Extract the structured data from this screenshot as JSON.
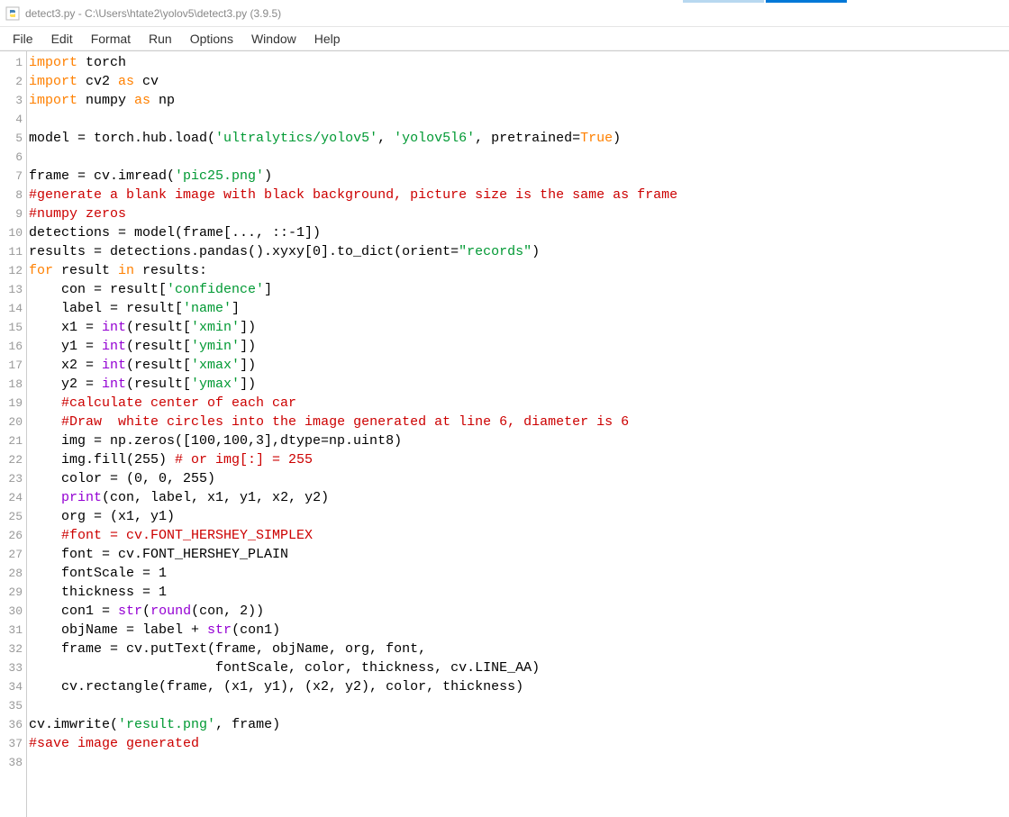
{
  "window": {
    "title": "detect3.py - C:\\Users\\htate2\\yolov5\\detect3.py (3.9.5)"
  },
  "menu": {
    "items": [
      "File",
      "Edit",
      "Format",
      "Run",
      "Options",
      "Window",
      "Help"
    ]
  },
  "code": {
    "lines": [
      [
        {
          "t": "import",
          "c": "kw"
        },
        {
          "t": " torch",
          "c": "blk"
        }
      ],
      [
        {
          "t": "import",
          "c": "kw"
        },
        {
          "t": " cv2 ",
          "c": "blk"
        },
        {
          "t": "as",
          "c": "kw"
        },
        {
          "t": " cv",
          "c": "blk"
        }
      ],
      [
        {
          "t": "import",
          "c": "kw"
        },
        {
          "t": " numpy ",
          "c": "blk"
        },
        {
          "t": "as",
          "c": "kw"
        },
        {
          "t": " np",
          "c": "blk"
        }
      ],
      [],
      [
        {
          "t": "model = torch.hub.load(",
          "c": "blk"
        },
        {
          "t": "'ultralytics/yolov5'",
          "c": "str"
        },
        {
          "t": ", ",
          "c": "blk"
        },
        {
          "t": "'yolov5l6'",
          "c": "str"
        },
        {
          "t": ", pretrained=",
          "c": "blk"
        },
        {
          "t": "True",
          "c": "kw"
        },
        {
          "t": ")",
          "c": "blk"
        }
      ],
      [],
      [
        {
          "t": "frame = cv.imread(",
          "c": "blk"
        },
        {
          "t": "'pic25.png'",
          "c": "str"
        },
        {
          "t": ")",
          "c": "blk"
        }
      ],
      [
        {
          "t": "#generate a blank image with black background, picture size is the same as frame",
          "c": "com"
        }
      ],
      [
        {
          "t": "#numpy zeros",
          "c": "com"
        }
      ],
      [
        {
          "t": "detections = model(frame[..., ::-1])",
          "c": "blk"
        }
      ],
      [
        {
          "t": "results = detections.pandas().xyxy[0].to_dict(orient=",
          "c": "blk"
        },
        {
          "t": "\"records\"",
          "c": "str"
        },
        {
          "t": ")",
          "c": "blk"
        }
      ],
      [
        {
          "t": "for",
          "c": "kw"
        },
        {
          "t": " result ",
          "c": "blk"
        },
        {
          "t": "in",
          "c": "kw"
        },
        {
          "t": " results:",
          "c": "blk"
        }
      ],
      [
        {
          "t": "    con = result[",
          "c": "blk"
        },
        {
          "t": "'confidence'",
          "c": "str"
        },
        {
          "t": "]",
          "c": "blk"
        }
      ],
      [
        {
          "t": "    label = result[",
          "c": "blk"
        },
        {
          "t": "'name'",
          "c": "str"
        },
        {
          "t": "]",
          "c": "blk"
        }
      ],
      [
        {
          "t": "    x1 = ",
          "c": "blk"
        },
        {
          "t": "int",
          "c": "bi"
        },
        {
          "t": "(result[",
          "c": "blk"
        },
        {
          "t": "'xmin'",
          "c": "str"
        },
        {
          "t": "])",
          "c": "blk"
        }
      ],
      [
        {
          "t": "    y1 = ",
          "c": "blk"
        },
        {
          "t": "int",
          "c": "bi"
        },
        {
          "t": "(result[",
          "c": "blk"
        },
        {
          "t": "'ymin'",
          "c": "str"
        },
        {
          "t": "])",
          "c": "blk"
        }
      ],
      [
        {
          "t": "    x2 = ",
          "c": "blk"
        },
        {
          "t": "int",
          "c": "bi"
        },
        {
          "t": "(result[",
          "c": "blk"
        },
        {
          "t": "'xmax'",
          "c": "str"
        },
        {
          "t": "])",
          "c": "blk"
        }
      ],
      [
        {
          "t": "    y2 = ",
          "c": "blk"
        },
        {
          "t": "int",
          "c": "bi"
        },
        {
          "t": "(result[",
          "c": "blk"
        },
        {
          "t": "'ymax'",
          "c": "str"
        },
        {
          "t": "])",
          "c": "blk"
        }
      ],
      [
        {
          "t": "    ",
          "c": "blk"
        },
        {
          "t": "#calculate center of each car",
          "c": "com"
        }
      ],
      [
        {
          "t": "    ",
          "c": "blk"
        },
        {
          "t": "#Draw  white circles into the image generated at line 6, diameter is 6",
          "c": "com"
        }
      ],
      [
        {
          "t": "    img = np.zeros([100,100,3],dtype=np.uint8)",
          "c": "blk"
        }
      ],
      [
        {
          "t": "    img.fill(255) ",
          "c": "blk"
        },
        {
          "t": "# or img[:] = 255",
          "c": "com"
        }
      ],
      [
        {
          "t": "    color = (0, 0, 255)",
          "c": "blk"
        }
      ],
      [
        {
          "t": "    ",
          "c": "blk"
        },
        {
          "t": "print",
          "c": "bi"
        },
        {
          "t": "(con, label, x1, y1, x2, y2)",
          "c": "blk"
        }
      ],
      [
        {
          "t": "    org = (x1, y1)",
          "c": "blk"
        }
      ],
      [
        {
          "t": "    ",
          "c": "blk"
        },
        {
          "t": "#font = cv.FONT_HERSHEY_SIMPLEX",
          "c": "com"
        }
      ],
      [
        {
          "t": "    font = cv.FONT_HERSHEY_PLAIN",
          "c": "blk"
        }
      ],
      [
        {
          "t": "    fontScale = 1",
          "c": "blk"
        }
      ],
      [
        {
          "t": "    thickness = 1",
          "c": "blk"
        }
      ],
      [
        {
          "t": "    con1 = ",
          "c": "blk"
        },
        {
          "t": "str",
          "c": "bi"
        },
        {
          "t": "(",
          "c": "blk"
        },
        {
          "t": "round",
          "c": "bi"
        },
        {
          "t": "(con, 2))",
          "c": "blk"
        }
      ],
      [
        {
          "t": "    objName = label + ",
          "c": "blk"
        },
        {
          "t": "str",
          "c": "bi"
        },
        {
          "t": "(con1)",
          "c": "blk"
        }
      ],
      [
        {
          "t": "    frame = cv.putText(frame, objName, org, font,",
          "c": "blk"
        }
      ],
      [
        {
          "t": "                       fontScale, color, thickness, cv.LINE_AA)",
          "c": "blk"
        }
      ],
      [
        {
          "t": "    cv.rectangle(frame, (x1, y1), (x2, y2), color, thickness)",
          "c": "blk"
        }
      ],
      [],
      [
        {
          "t": "cv.imwrite(",
          "c": "blk"
        },
        {
          "t": "'result.png'",
          "c": "str"
        },
        {
          "t": ", frame)",
          "c": "blk"
        }
      ],
      [
        {
          "t": "#save image generated",
          "c": "com"
        }
      ],
      []
    ]
  }
}
